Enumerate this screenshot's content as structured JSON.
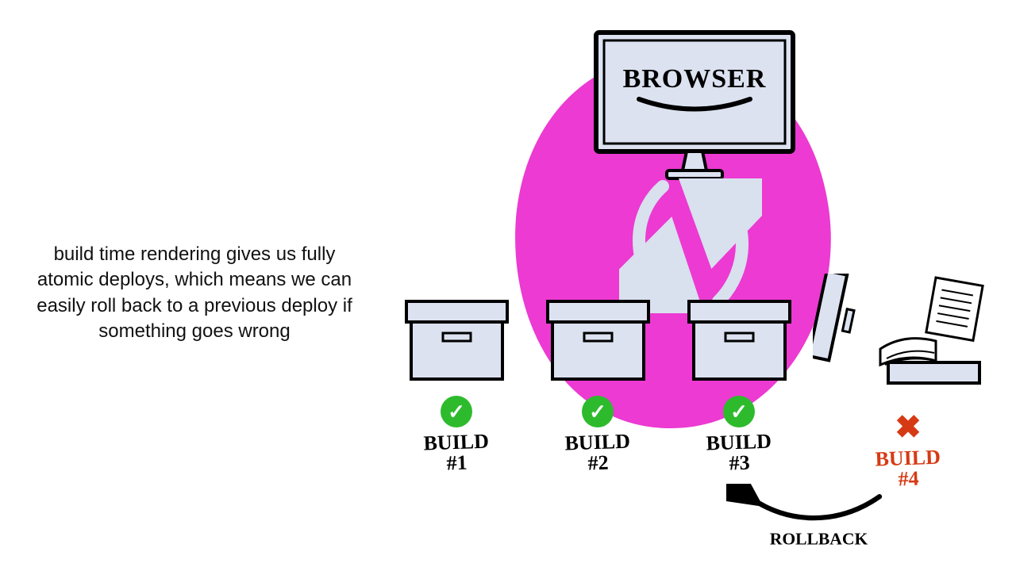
{
  "caption": "build time rendering gives us fully atomic deploys, which means we can easily roll back to a previous deploy if something goes wrong",
  "monitor_label": "BROWSER",
  "builds": [
    {
      "label_line1": "BUILD",
      "label_line2": "#1",
      "status": "ok"
    },
    {
      "label_line1": "BUILD",
      "label_line2": "#2",
      "status": "ok"
    },
    {
      "label_line1": "BUILD",
      "label_line2": "#3",
      "status": "ok"
    },
    {
      "label_line1": "BUILD",
      "label_line2": "#4",
      "status": "fail"
    }
  ],
  "rollback_label": "ROLLBACK",
  "colors": {
    "blob": "#ec3ad2",
    "box_fill": "#dce2f0",
    "arrow_fill": "#d9e0ee",
    "success": "#2dbb2d",
    "fail": "#d63a14"
  }
}
